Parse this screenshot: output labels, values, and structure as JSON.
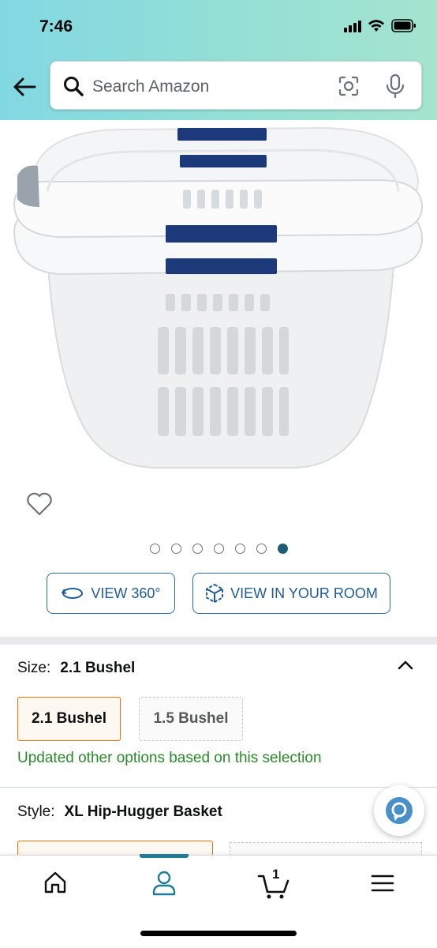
{
  "status_bar": {
    "time": "7:46",
    "icons": [
      "cellular-signal-icon",
      "wifi-icon",
      "battery-icon"
    ]
  },
  "header": {
    "back_icon": "back-arrow-icon",
    "search": {
      "placeholder": "Search Amazon",
      "icons": [
        "search-icon",
        "camera-scan-icon",
        "microphone-icon"
      ]
    }
  },
  "product": {
    "image_alt": "White plastic laundry basket with navy blue handles",
    "wishlist_icon": "heart-outline-icon",
    "carousel": {
      "total_images": 7,
      "active_index": 7
    },
    "view_360_label": "VIEW 360°",
    "view_in_room_label": "VIEW IN YOUR ROOM"
  },
  "size_section": {
    "label": "Size:",
    "selected_value": "2.1 Bushel",
    "options": [
      "2.1 Bushel",
      "1.5 Bushel"
    ],
    "update_message": "Updated other options based on this selection"
  },
  "style_section": {
    "label": "Style:",
    "selected_value": "XL Hip-Hugger Basket"
  },
  "bottom_nav": {
    "items": [
      "home-icon",
      "account-icon",
      "cart-icon",
      "menu-icon"
    ],
    "active": "account-icon",
    "cart_count": "1"
  },
  "colors": {
    "header_gradient_start": "#82d8e3",
    "header_gradient_end": "#a5e4cf",
    "link_blue": "#1f5c99",
    "selected_orange": "#e77600",
    "success_green": "#2a8a2a",
    "nav_active": "#1e7c95"
  }
}
